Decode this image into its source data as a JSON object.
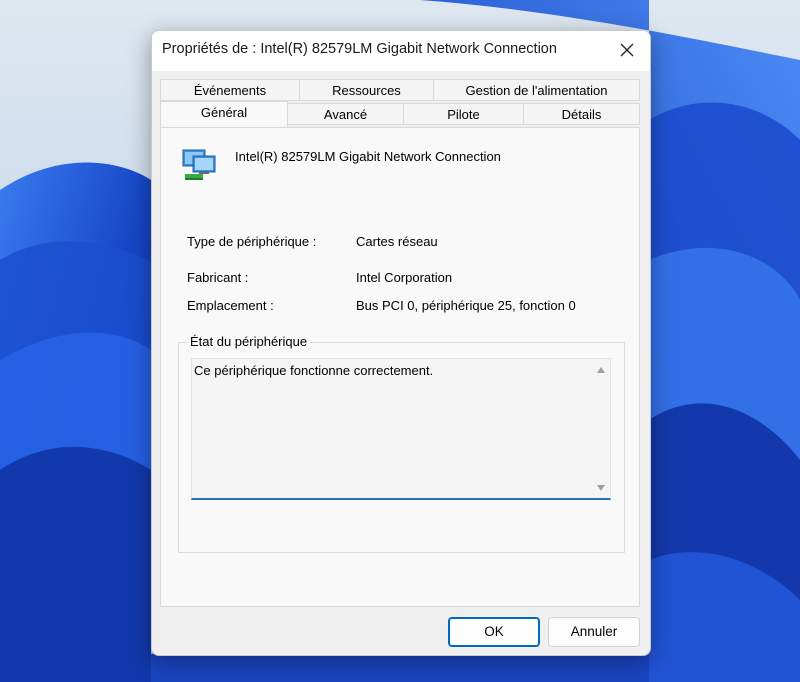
{
  "window": {
    "title": "Propriétés de : Intel(R) 82579LM Gigabit Network Connection"
  },
  "tabs": {
    "row_back": [
      {
        "label": "Événements"
      },
      {
        "label": "Ressources"
      },
      {
        "label": "Gestion de l'alimentation"
      }
    ],
    "row_front": [
      {
        "label": "Général",
        "active": true
      },
      {
        "label": "Avancé"
      },
      {
        "label": "Pilote"
      },
      {
        "label": "Détails"
      }
    ]
  },
  "general": {
    "device_name": "Intel(R) 82579LM Gigabit Network Connection",
    "device_icon": "network-adapter-icon",
    "properties": [
      {
        "label": "Type de périphérique :",
        "value": "Cartes réseau"
      },
      {
        "label": "Fabricant :",
        "value": "Intel Corporation"
      },
      {
        "label": "Emplacement :",
        "value": "Bus PCI 0, périphérique 25, fonction 0"
      }
    ],
    "status": {
      "title": "État du périphérique",
      "text": "Ce périphérique fonctionne correctement."
    }
  },
  "buttons": {
    "ok": "OK",
    "cancel": "Annuler"
  },
  "colors": {
    "accent": "#0067c0",
    "wallpaper_blue": "#1b4fd0",
    "wallpaper_light": "#c4d8ea"
  }
}
